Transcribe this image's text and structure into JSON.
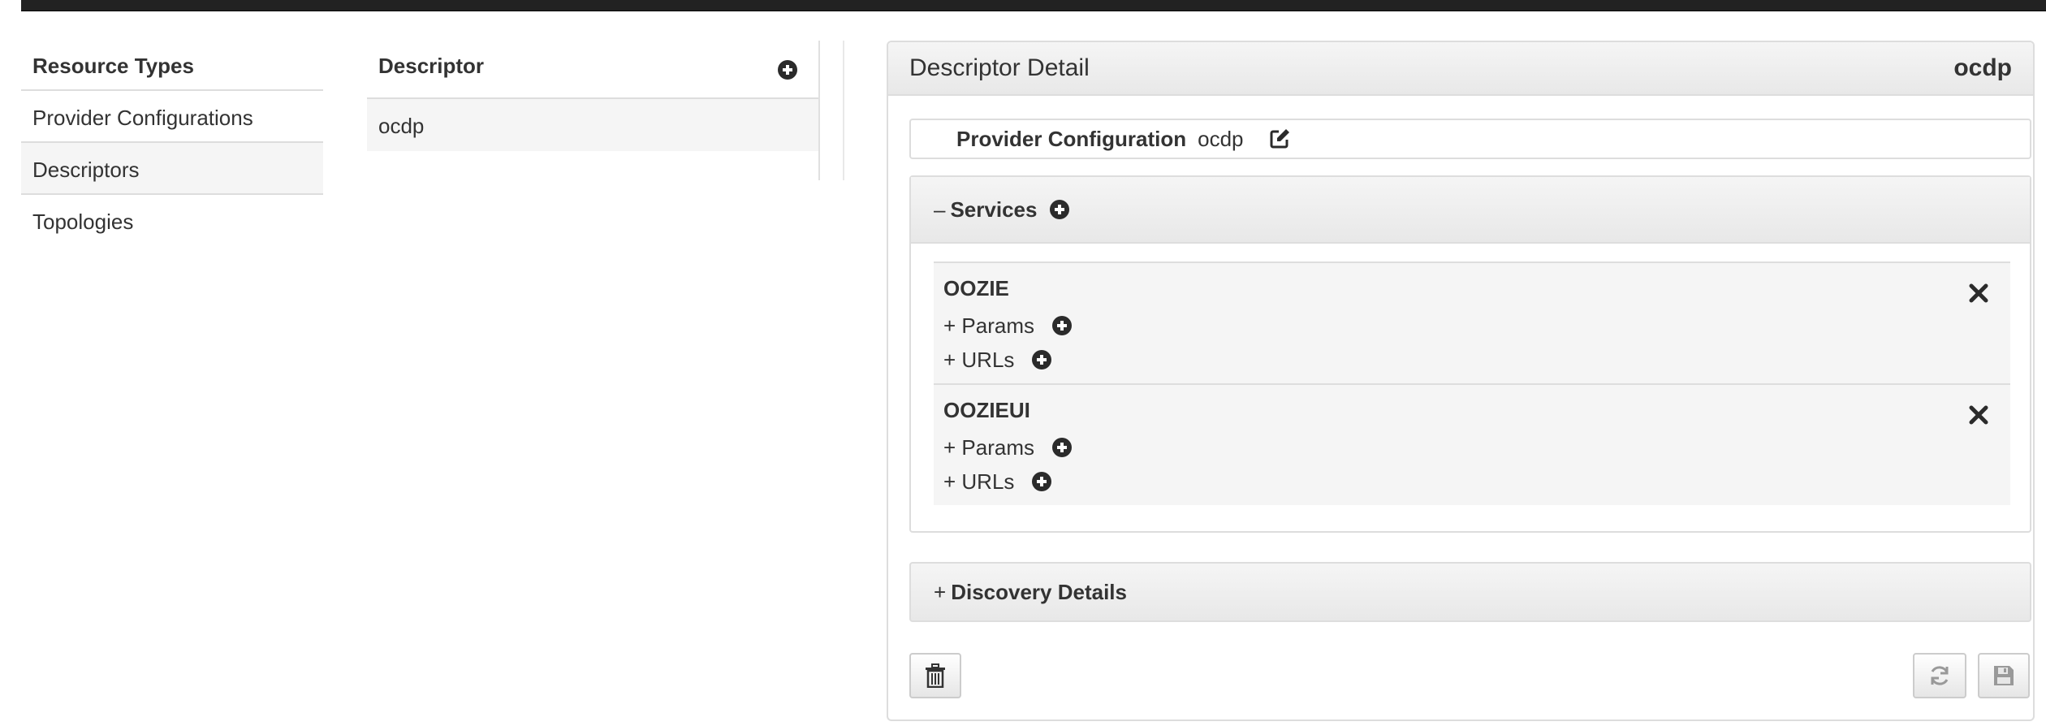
{
  "resource_types": {
    "header": "Resource Types",
    "items": [
      {
        "label": "Provider Configurations"
      },
      {
        "label": "Descriptors"
      },
      {
        "label": "Topologies"
      }
    ]
  },
  "descriptors": {
    "header": "Descriptor",
    "items": [
      {
        "label": "ocdp"
      }
    ]
  },
  "detail": {
    "title": "Descriptor Detail",
    "name": "ocdp",
    "provider_configuration_label": "Provider Configuration",
    "provider_configuration_value": "ocdp",
    "services_toggle": "–",
    "services_label": "Services",
    "services": [
      {
        "name": "OOZIE",
        "params_label": "+ Params",
        "urls_label": "+ URLs"
      },
      {
        "name": "OOZIEUI",
        "params_label": "+ Params",
        "urls_label": "+ URLs"
      }
    ],
    "discovery_toggle": "+",
    "discovery_label": "Discovery Details"
  },
  "icons": {
    "add": "circle-plus-icon",
    "edit": "edit-icon",
    "remove": "close-icon",
    "delete": "trash-icon",
    "reset": "refresh-icon",
    "save": "save-icon"
  },
  "colors": {
    "topbar": "#222222",
    "active_row": "#f5f5f5",
    "border": "#dddddd",
    "icon": "#2b2b2b"
  }
}
